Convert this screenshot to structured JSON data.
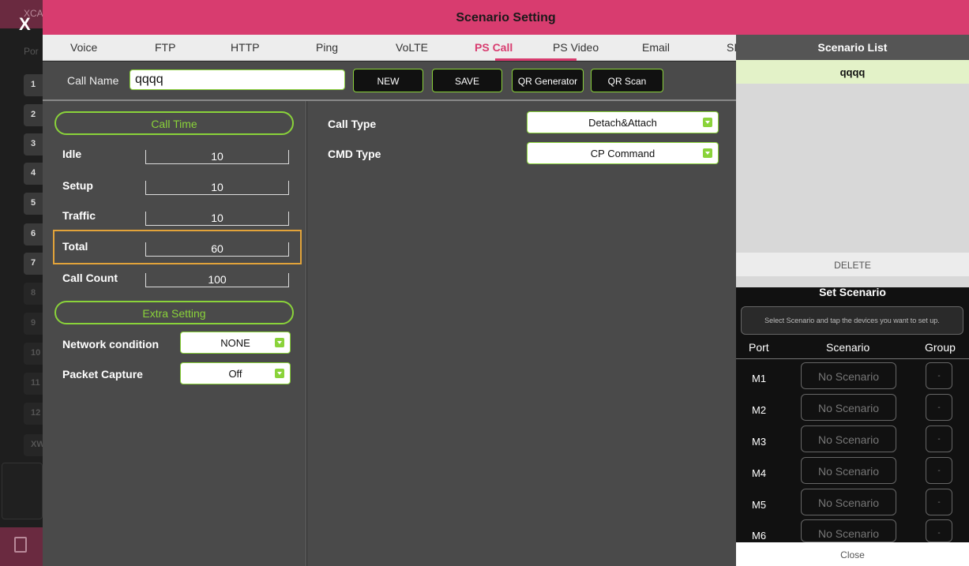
{
  "window": {
    "title": "Scenario Setting",
    "close_label": "X"
  },
  "background_strip": {
    "app_label": "XCA",
    "port_header": "Por",
    "ports": [
      "1",
      "2",
      "3",
      "4",
      "5",
      "6",
      "7",
      "8",
      "9",
      "10",
      "11",
      "12",
      "XW"
    ]
  },
  "tabs": {
    "items": [
      "Voice",
      "FTP",
      "HTTP",
      "Ping",
      "VoLTE",
      "PS Call",
      "PS Video",
      "Email",
      "SI"
    ],
    "active": "PS Call"
  },
  "call_name": {
    "label": "Call Name",
    "value": "qqqq",
    "buttons": {
      "new": "NEW",
      "save": "SAVE",
      "qr_generator": "QR Generator",
      "qr_scan": "QR Scan"
    }
  },
  "call_time": {
    "section_label": "Call Time",
    "fields": [
      {
        "label": "Idle",
        "value": "10"
      },
      {
        "label": "Setup",
        "value": "10"
      },
      {
        "label": "Traffic",
        "value": "10"
      },
      {
        "label": "Total",
        "value": "60"
      },
      {
        "label": "Call Count",
        "value": "100"
      }
    ]
  },
  "extra_setting": {
    "section_label": "Extra Setting",
    "network_condition": {
      "label": "Network condition",
      "value": "NONE"
    },
    "packet_capture": {
      "label": "Packet Capture",
      "value": "Off"
    }
  },
  "call_config": {
    "call_type": {
      "label": "Call Type",
      "value": "Detach&Attach"
    },
    "cmd_type": {
      "label": "CMD Type",
      "value": "CP Command"
    }
  },
  "scenario_list": {
    "title": "Scenario List",
    "items": [
      "qqqq"
    ],
    "delete_label": "DELETE"
  },
  "set_scenario": {
    "title": "Set Scenario",
    "hint": "Select Scenario and tap the devices you want to set up.",
    "columns": {
      "port": "Port",
      "scenario": "Scenario",
      "group": "Group"
    },
    "rows": [
      {
        "port": "M1",
        "scenario": "No Scenario",
        "group": "-"
      },
      {
        "port": "M2",
        "scenario": "No Scenario",
        "group": "-"
      },
      {
        "port": "M3",
        "scenario": "No Scenario",
        "group": "-"
      },
      {
        "port": "M4",
        "scenario": "No Scenario",
        "group": "-"
      },
      {
        "port": "M5",
        "scenario": "No Scenario",
        "group": "-"
      },
      {
        "port": "M6",
        "scenario": "No Scenario",
        "group": "-"
      }
    ],
    "close_label": "Close"
  },
  "colors": {
    "brand": "#d83c6f",
    "accent_green": "#8ad33a",
    "highlight_orange": "#e2a33a"
  }
}
